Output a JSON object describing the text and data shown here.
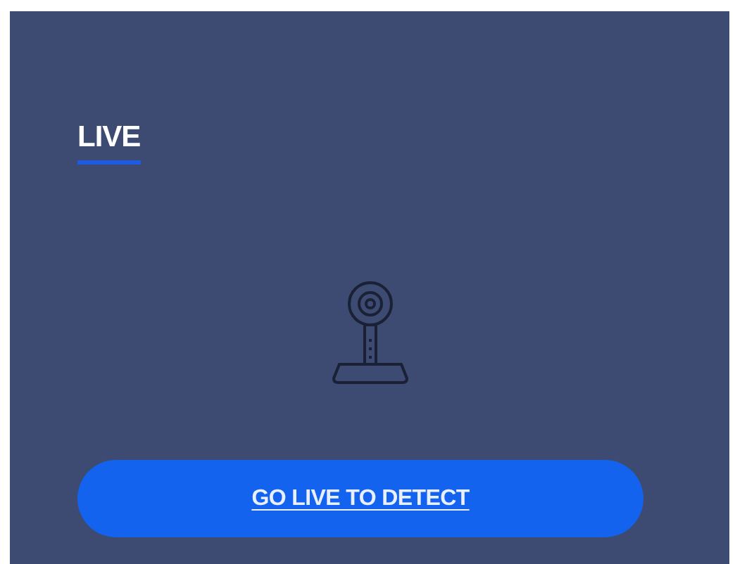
{
  "tabs": [
    {
      "label": "LIVE",
      "selected": true
    }
  ],
  "action_button": {
    "label": "GO LIVE TO DETECT"
  }
}
